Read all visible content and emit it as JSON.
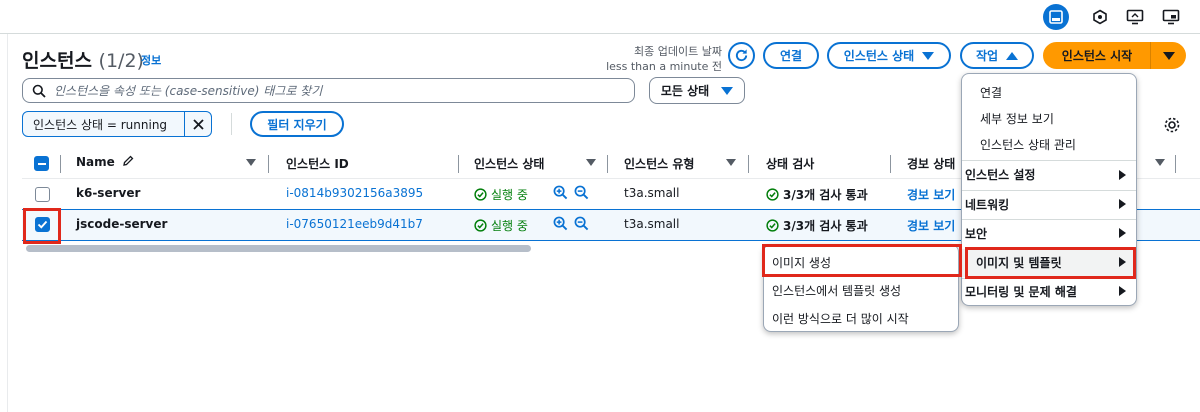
{
  "header": {
    "title": "인스턴스",
    "count": "(1/2)",
    "info": "정보",
    "last_updated_label": "최종 업데이트 날짜",
    "last_updated_value": "less than a minute 전",
    "connect_label": "연결",
    "instance_state_label": "인스턴스 상태",
    "actions_label": "작업",
    "launch_label": "인스턴스 시작"
  },
  "search": {
    "placeholder": "인스턴스을 속성 또는 (case-sensitive) 태그로 찾기"
  },
  "state_filter": {
    "selected": "모든 상태"
  },
  "filter_token": {
    "label": "인스턴스 상태 = running"
  },
  "clear_filters_label": "필터 지우기",
  "table": {
    "columns": [
      "Name",
      "인스턴스 ID",
      "인스턴스 상태",
      "인스턴스 유형",
      "상태 검사",
      "경보 상태"
    ],
    "rows": [
      {
        "name": "k6-server",
        "id": "i-0814b9302156a3895",
        "state": "실행 중",
        "type": "t3a.small",
        "check": "3/3개 검사 통과",
        "alarm": "경보 보기"
      },
      {
        "name": "jscode-server",
        "id": "i-07650121eeb9d41b7",
        "state": "실행 중",
        "type": "t3a.small",
        "check": "3/3개 검사 통과",
        "alarm": "경보 보기"
      }
    ]
  },
  "actions_menu": {
    "items": [
      {
        "label": "연결"
      },
      {
        "label": "세부 정보 보기"
      },
      {
        "label": "인스턴스 상태 관리"
      },
      {
        "label": "인스턴스 설정"
      },
      {
        "label": "네트워킹"
      },
      {
        "label": "보안"
      },
      {
        "label": "이미지 및 템플릿"
      },
      {
        "label": "모니터링 및 문제 해결"
      }
    ]
  },
  "submenu": {
    "items": [
      {
        "label": "이미지 생성"
      },
      {
        "label": "인스턴스에서 템플릿 생성"
      },
      {
        "label": "이런 방식으로 더 많이 시작"
      }
    ]
  },
  "colors": {
    "accent": "#0972d3",
    "primary": "#ff9900",
    "success": "#037f0c",
    "highlight": "#e0281b"
  }
}
